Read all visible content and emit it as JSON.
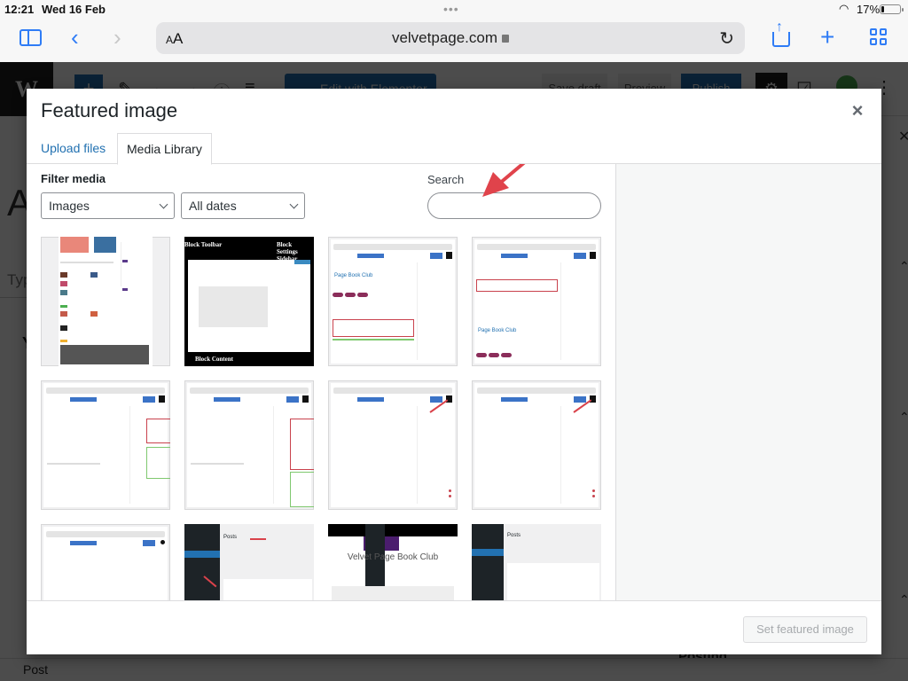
{
  "status_bar": {
    "time": "12:21",
    "date": "Wed 16 Feb",
    "battery_percent": "17%",
    "battery_level": 0.17
  },
  "browser": {
    "text_size_label_small": "A",
    "text_size_label_large": "A",
    "url": "velvetpage.com",
    "accent_color": "#2f7cf6"
  },
  "editor_background": {
    "edit_with_elementor_label": "Edit with Elementor",
    "save_draft_label": "Save draft",
    "preview_label": "Preview",
    "publish_label": "Publish",
    "title_fragment": "A",
    "placeholder_fragment": "Typ",
    "section_fragment": "Y",
    "footer_label": "Post",
    "right_panel_fragment": "Posting"
  },
  "modal": {
    "title": "Featured image",
    "close_label": "×",
    "tabs": [
      {
        "label": "Upload files",
        "active": false
      },
      {
        "label": "Media Library",
        "active": true
      }
    ],
    "filter": {
      "label": "Filter media",
      "type_select": {
        "selected": "Images"
      },
      "date_select": {
        "selected": "All dates"
      }
    },
    "search": {
      "label": "Search",
      "value": "",
      "placeholder": ""
    },
    "thumbnails": [
      {
        "description": "Website homepage screenshot with book covers and author photos"
      },
      {
        "description": "Block editor diagram",
        "labels": [
          "Block Toolbar",
          "Block Settings Sidebar",
          "Block Content"
        ]
      },
      {
        "description": "Editor screenshot",
        "visible_text": "Page Book Club"
      },
      {
        "description": "Editor screenshot",
        "visible_text": "Page Book Club"
      },
      {
        "description": "Editor screenshot with featured image and excerpt highlighted"
      },
      {
        "description": "Editor screenshot with categories and tags highlighted"
      },
      {
        "description": "Editor screenshot with settings arrow"
      },
      {
        "description": "Editor screenshot with settings arrow"
      },
      {
        "description": "Editor screenshot, blank post"
      },
      {
        "description": "Posts admin screen with Add New arrow",
        "visible_text": "Posts"
      },
      {
        "description": "Site menu screenshot",
        "visible_text": "Velvet Page Book Club"
      },
      {
        "description": "Posts admin list screen",
        "visible_text": "Posts"
      }
    ],
    "footer": {
      "set_featured_button_label": "Set featured image",
      "set_featured_button_disabled": true
    }
  },
  "annotation": {
    "arrow_color": "#e0434b",
    "points_to": "Search"
  }
}
